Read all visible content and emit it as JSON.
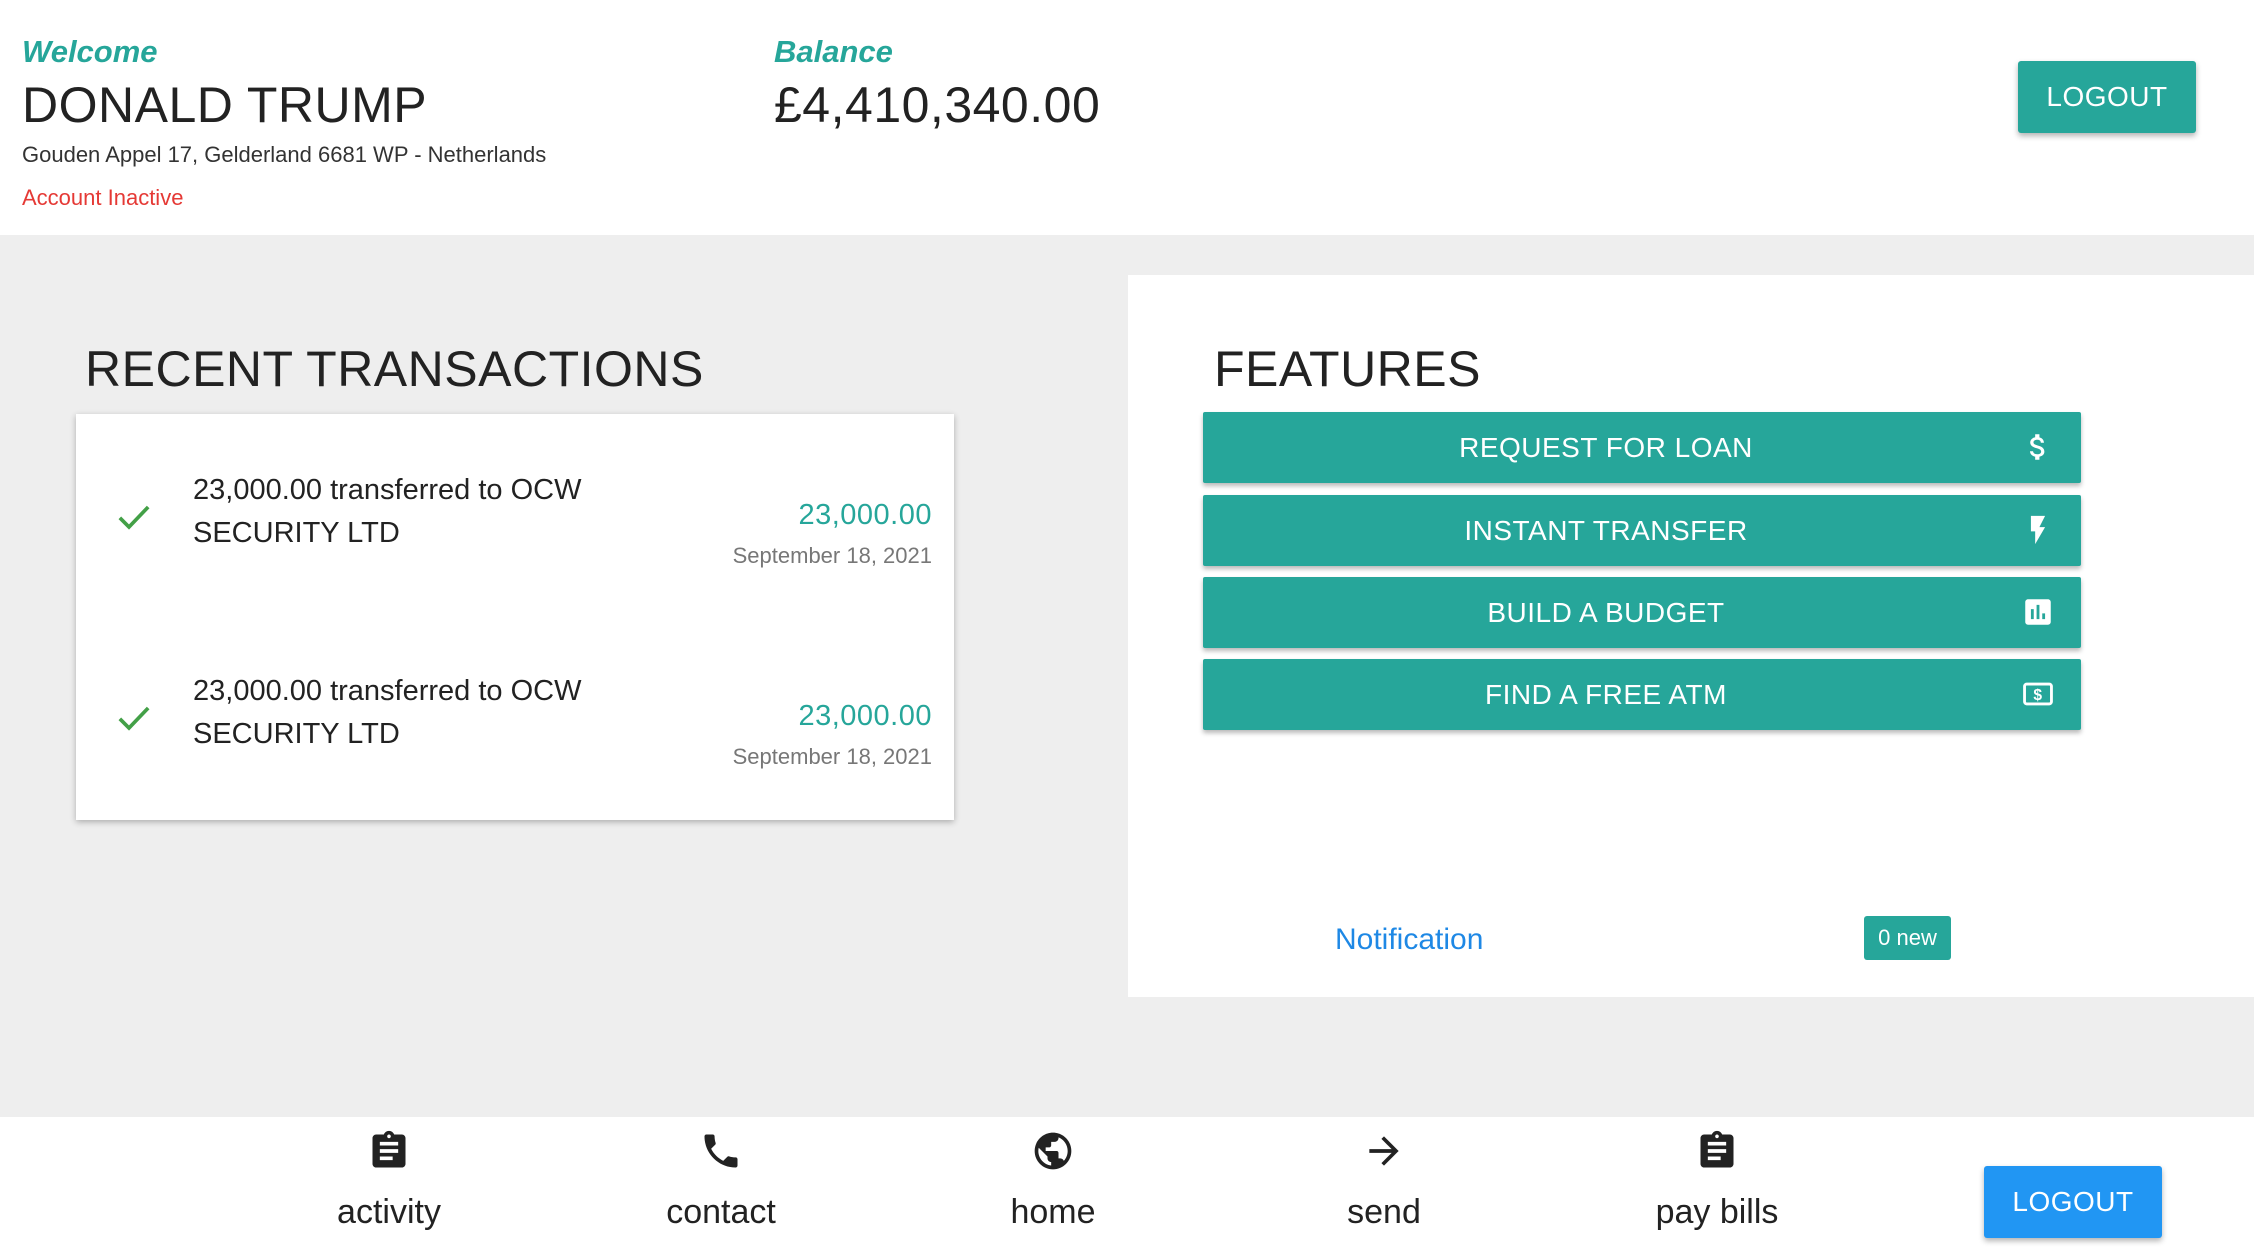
{
  "header": {
    "welcome_label": "Welcome",
    "user_name": "DONALD TRUMP",
    "address": "Gouden Appel 17, Gelderland 6681 WP - Netherlands",
    "account_status": "Account Inactive",
    "balance_label": "Balance",
    "balance_value": "£4,410,340.00",
    "logout_label": "LOGOUT"
  },
  "transactions": {
    "title": "RECENT TRANSACTIONS",
    "items": [
      {
        "description": "23,000.00 transferred to OCW SECURITY LTD",
        "amount": "23,000.00",
        "date": "September 18, 2021",
        "status_icon": "check-icon"
      },
      {
        "description": "23,000.00 transferred to OCW SECURITY LTD",
        "amount": "23,000.00",
        "date": "September 18, 2021",
        "status_icon": "check-icon"
      }
    ]
  },
  "features": {
    "title": "FEATURES",
    "buttons": [
      {
        "label": "REQUEST FOR LOAN",
        "icon": "dollar-icon"
      },
      {
        "label": "INSTANT TRANSFER",
        "icon": "flash-icon"
      },
      {
        "label": "BUILD A BUDGET",
        "icon": "bar-chart-icon"
      },
      {
        "label": "FIND A FREE ATM",
        "icon": "money-icon"
      }
    ],
    "notification_label": "Notification",
    "notification_badge": "0 new"
  },
  "bottom_nav": {
    "items": [
      {
        "label": "activity",
        "icon": "clipboard-icon"
      },
      {
        "label": "contact",
        "icon": "phone-icon"
      },
      {
        "label": "home",
        "icon": "globe-icon"
      },
      {
        "label": "send",
        "icon": "arrow-right-icon"
      },
      {
        "label": "pay bills",
        "icon": "clipboard-icon"
      }
    ],
    "logout_label": "LOGOUT"
  },
  "colors": {
    "accent": "#26a69a",
    "link": "#1e88e5",
    "danger": "#e53935",
    "logout_bottom": "#2196f3",
    "background": "#eeeeee",
    "check": "#43a047"
  }
}
